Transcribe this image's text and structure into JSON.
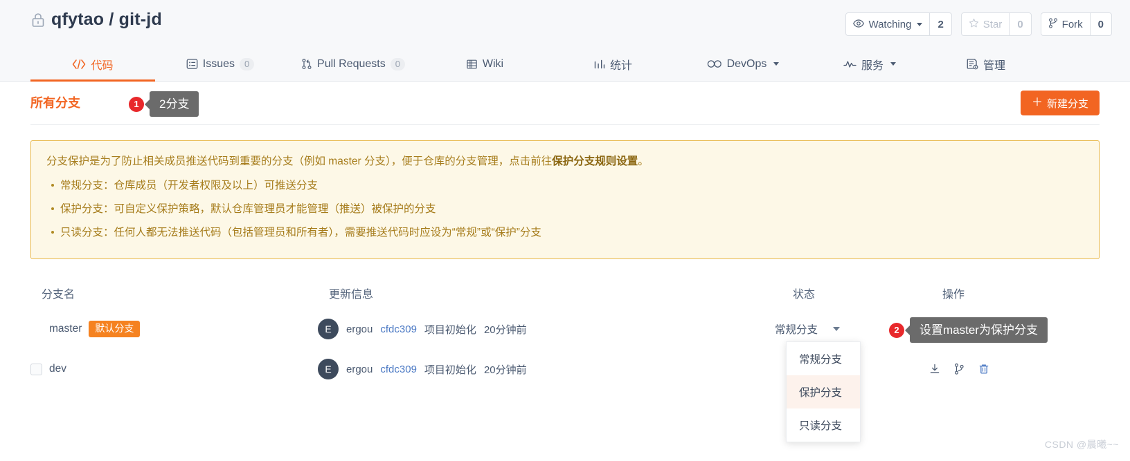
{
  "header": {
    "lock_icon": "lock-icon",
    "repo_owner": "qfytao",
    "repo_separator": "/",
    "repo_name": "git-jd",
    "repo_full": "qfytao / git-jd",
    "actions": [
      {
        "icon": "eye-icon",
        "label": "Watching",
        "count": "2",
        "has_caret": true,
        "disabled": false
      },
      {
        "icon": "star-icon",
        "label": "Star",
        "count": "0",
        "has_caret": false,
        "disabled": true
      },
      {
        "icon": "fork-icon",
        "label": "Fork",
        "count": "0",
        "has_caret": false,
        "disabled": false
      }
    ]
  },
  "nav": {
    "tabs": [
      {
        "icon": "code-icon",
        "label": "代码",
        "badge": "",
        "caret": false,
        "active": true
      },
      {
        "icon": "issues-icon",
        "label": "Issues",
        "badge": "0",
        "caret": false,
        "active": false
      },
      {
        "icon": "pull-request-icon",
        "label": "Pull Requests",
        "badge": "0",
        "caret": false,
        "active": false
      },
      {
        "icon": "wiki-icon",
        "label": "Wiki",
        "badge": "",
        "caret": false,
        "active": false
      },
      {
        "icon": "stats-icon",
        "label": "统计",
        "badge": "",
        "caret": false,
        "active": false
      },
      {
        "icon": "devops-icon",
        "label": "DevOps",
        "badge": "",
        "caret": true,
        "active": false
      },
      {
        "icon": "service-icon",
        "label": "服务",
        "badge": "",
        "caret": true,
        "active": false
      },
      {
        "icon": "manage-icon",
        "label": "管理",
        "badge": "",
        "caret": false,
        "active": false
      }
    ]
  },
  "branches": {
    "section_title": "所有分支",
    "new_branch_label": "新建分支",
    "new_branch_plus": "＋",
    "marker_1": {
      "number": "1",
      "tooltip": "2分支"
    },
    "marker_2": {
      "number": "2",
      "tooltip": "设置master为保护分支"
    }
  },
  "warning": {
    "lead_part1": "分支保护是为了防止相关成员推送代码到重要的分支（例如 master 分支），便于仓库的分支管理，点击前往",
    "lead_link": "保护分支规则设置",
    "lead_part2": "。",
    "bullets": [
      "常规分支：仓库成员（开发者权限及以上）可推送分支",
      "保护分支：可自定义保护策略，默认仓库管理员才能管理（推送）被保护的分支",
      "只读分支：任何人都无法推送代码（包括管理员和所有者），需要推送代码时应设为“常规”或“保护”分支"
    ]
  },
  "table": {
    "columns": {
      "name": "分支名",
      "info": "更新信息",
      "status": "状态",
      "ops": "操作"
    },
    "rows": [
      {
        "checkbox": false,
        "name": "master",
        "tag": "默认分支",
        "avatar": "E",
        "author": "ergou",
        "sha": "cfdc309",
        "message": "项目初始化",
        "time": "20分钟前",
        "status": "常规分支",
        "show_ops": false
      },
      {
        "checkbox": true,
        "name": "dev",
        "tag": "",
        "avatar": "E",
        "author": "ergou",
        "sha": "cfdc309",
        "message": "项目初始化",
        "time": "20分钟前",
        "status": "",
        "show_ops": true
      }
    ],
    "ops_icons": [
      "download-icon",
      "merge-branch-icon",
      "trash-icon"
    ]
  },
  "dropdown": {
    "items": [
      {
        "label": "常规分支",
        "selected": false
      },
      {
        "label": "保护分支",
        "selected": true
      },
      {
        "label": "只读分支",
        "selected": false
      }
    ]
  },
  "watermark": "CSDN @晨曦~~",
  "colors": {
    "accent": "#f26522",
    "warning_bg": "#fdf8e7",
    "warning_border": "#e8b84b",
    "warning_text": "#a67c1b",
    "badge_red": "#e8282b",
    "tooltip_gray": "#6b6b6b",
    "link_blue": "#4b79c4"
  }
}
